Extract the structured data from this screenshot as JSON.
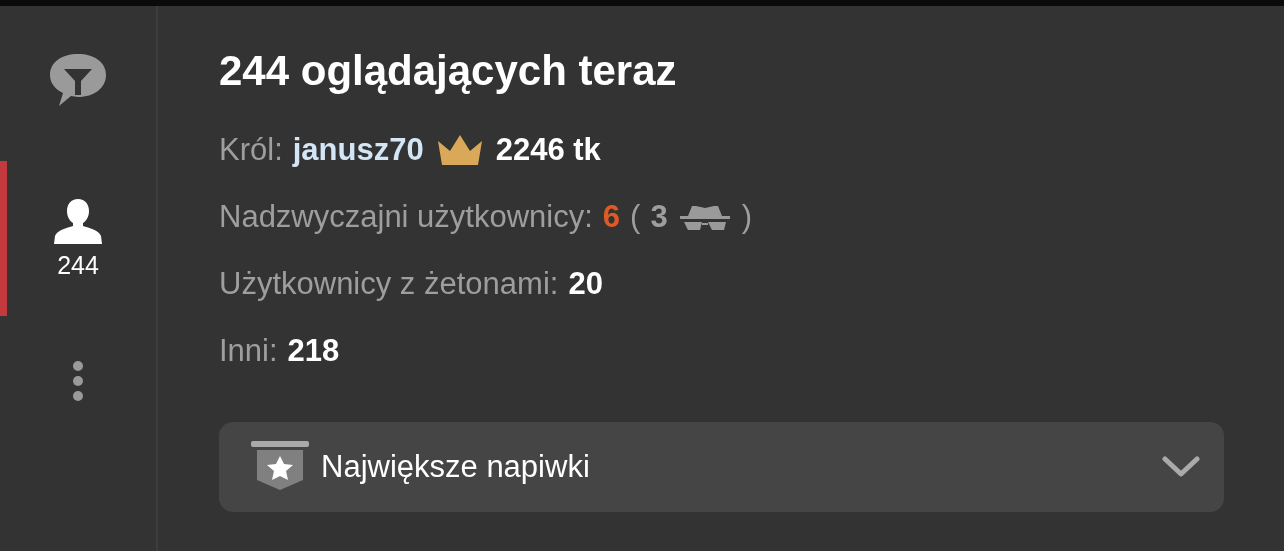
{
  "sidebar": {
    "items": [
      {
        "kind": "chat",
        "selected": false
      },
      {
        "kind": "users",
        "count": "244",
        "selected": true
      },
      {
        "kind": "more",
        "selected": false
      }
    ]
  },
  "title": "244 oglądających teraz",
  "king": {
    "label": "Król:",
    "username": "janusz70",
    "amount": "2246 tk"
  },
  "stats": [
    {
      "kind": "special",
      "label": "Nadzwyczajni użytkownicy:",
      "value": "6",
      "open_paren": "(",
      "hidden_count": "3",
      "close_paren": ")"
    },
    {
      "kind": "plain",
      "label": "Użytkownicy z żetonami:",
      "value": "20"
    },
    {
      "kind": "plain",
      "label": "Inni:",
      "value": "218"
    }
  ],
  "dropdown": {
    "label": "Największe napiwki",
    "expanded": false
  }
}
